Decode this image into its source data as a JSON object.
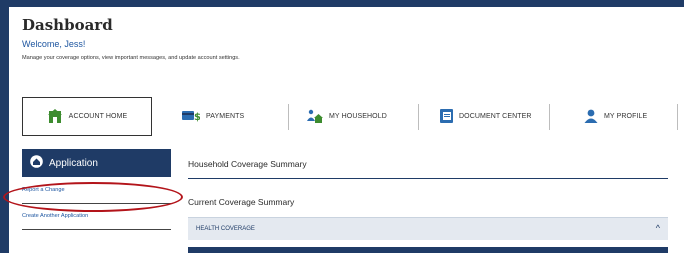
{
  "header": {
    "title": "Dashboard",
    "welcome": "Welcome, Jess!",
    "subtitle": "Manage your coverage options, view important messages, and update account settings."
  },
  "nav": {
    "account_home": "ACCOUNT HOME",
    "payments": "PAYMENTS",
    "my_household": "MY HOUSEHOLD",
    "document_center": "DOCUMENT CENTER",
    "my_profile": "MY PROFILE"
  },
  "sidebar": {
    "heading": "Application",
    "items": [
      {
        "label": "Report a Change"
      },
      {
        "label": "Create Another Application"
      }
    ]
  },
  "main": {
    "household_summary": "Household Coverage Summary",
    "current_summary": "Current Coverage Summary",
    "health_coverage": "HEALTH COVERAGE"
  },
  "colors": {
    "navy": "#1f3b66",
    "link": "#1e56a0",
    "highlight_oval": "#b3141a",
    "icon_green": "#3d8c2f"
  }
}
